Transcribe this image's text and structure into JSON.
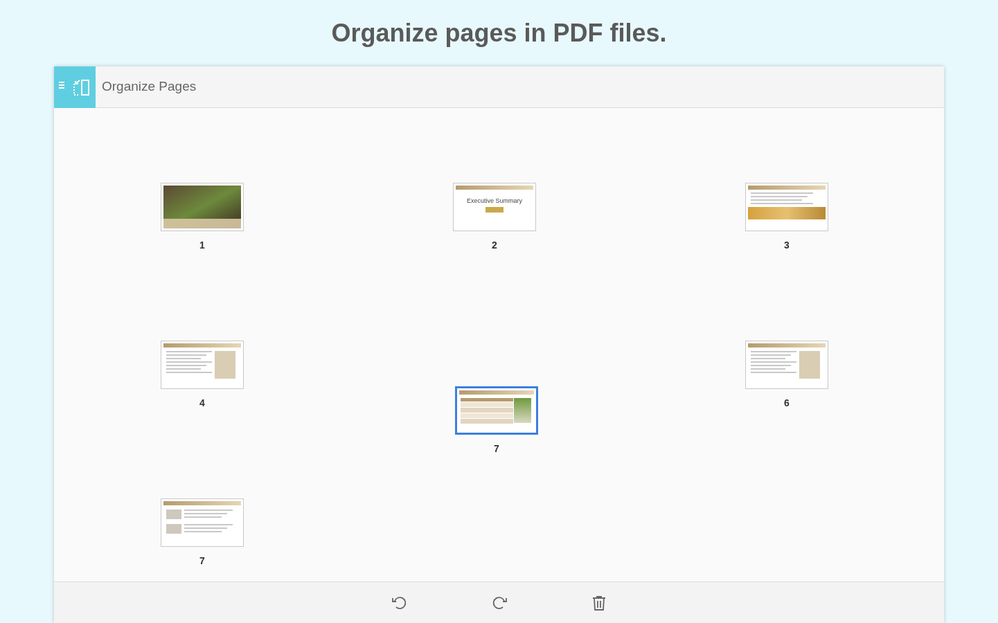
{
  "headline": "Organize pages in PDF files.",
  "app_bar": {
    "title": "Organize Pages"
  },
  "pages": [
    {
      "kind": "cover",
      "label": "1"
    },
    {
      "kind": "section",
      "label": "2",
      "caption": "Executive Summary"
    },
    {
      "kind": "text_photo",
      "label": "3"
    },
    {
      "kind": "text_figure",
      "label": "4"
    },
    {
      "kind": "empty"
    },
    {
      "kind": "text_figure",
      "label": "6"
    },
    {
      "kind": "list",
      "label": "7"
    }
  ],
  "dragged_page": {
    "kind": "table",
    "label": "7",
    "selected": true
  },
  "toolbar": [
    {
      "kind": "rotate_left"
    },
    {
      "kind": "rotate_right"
    },
    {
      "kind": "delete"
    }
  ]
}
